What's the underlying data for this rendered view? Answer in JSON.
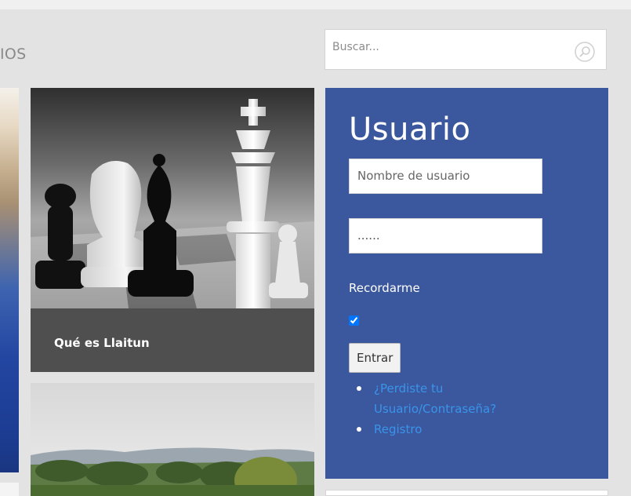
{
  "nav": {
    "partial_label": "IOS"
  },
  "search": {
    "placeholder": "Buscar..."
  },
  "articles": [
    {
      "title": "Qué es Llaitun"
    }
  ],
  "login": {
    "title": "Usuario",
    "username_placeholder": "Nombre de usuario",
    "password_value": "......",
    "remember_label": "Recordarme",
    "remember_checked": true,
    "submit_label": "Entrar",
    "links": [
      {
        "label": "¿Perdiste tu Usuario/Contraseña?"
      },
      {
        "label": "Registro"
      }
    ]
  },
  "colors": {
    "login_panel": "#3b579d",
    "link": "#3994ea",
    "card_caption_bg": "#4f4f4f"
  },
  "icons": {
    "search": "search-icon"
  }
}
